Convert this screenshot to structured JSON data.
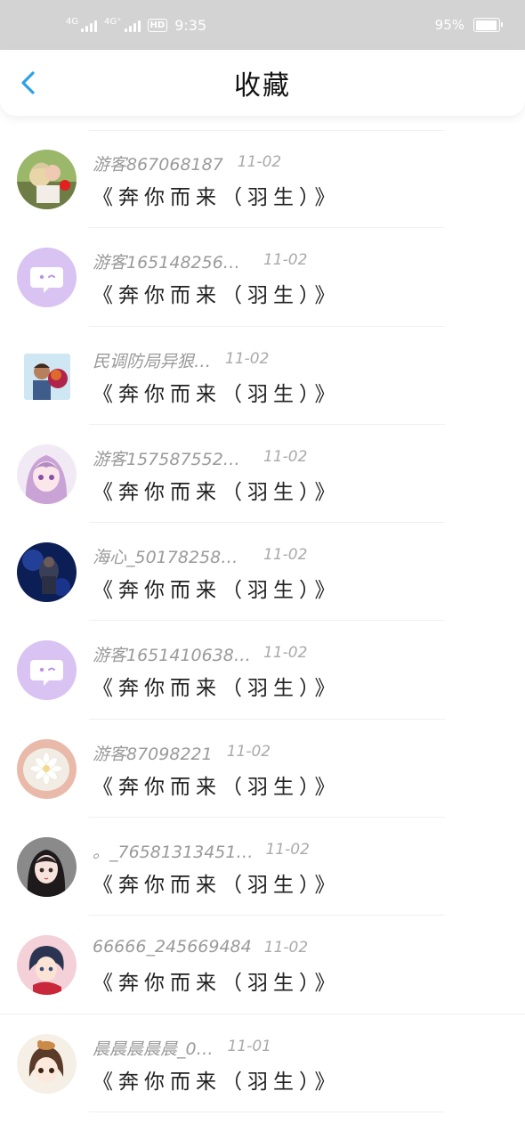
{
  "status_bar": {
    "network1": "4G",
    "network2": "4G⁺",
    "hd": "HD",
    "time": "9:35",
    "battery_text": "95%",
    "battery_level": 0.95
  },
  "header": {
    "title": "收藏",
    "back_icon": "chevron-left-icon",
    "accent_color": "#2e9fe8"
  },
  "favorites": [
    {
      "user": "游客867068187",
      "date": "11-02",
      "title": "《奔你而来（羽生）》",
      "avatar": "photo-couple"
    },
    {
      "user": "游客165148256…",
      "date": "11-02",
      "title": "《奔你而来（羽生）》",
      "avatar": "default-chat"
    },
    {
      "user": "民调防局异狠…",
      "date": "11-02",
      "title": "《奔你而来（羽生）》",
      "avatar": "photo-man"
    },
    {
      "user": "游客157587552…",
      "date": "11-02",
      "title": "《奔你而来（羽生）》",
      "avatar": "anime-girl-purple"
    },
    {
      "user": "海心_50178258…",
      "date": "11-02",
      "title": "《奔你而来（羽生）》",
      "avatar": "photo-night"
    },
    {
      "user": "游客1651410638…",
      "date": "11-02",
      "title": "《奔你而来（羽生）》",
      "avatar": "default-chat"
    },
    {
      "user": "游客87098221",
      "date": "11-02",
      "title": "《奔你而来（羽生）》",
      "avatar": "photo-flower"
    },
    {
      "user": "。_76581313451…",
      "date": "11-02",
      "title": "《奔你而来（羽生）》",
      "avatar": "anime-girl-dark"
    },
    {
      "user": "66666_245669484",
      "date": "11-02",
      "title": "《奔你而来（羽生）》",
      "avatar": "anime-boy"
    },
    {
      "user": "晨晨晨晨晨_0…",
      "date": "11-01",
      "title": "《奔你而来（羽生）》",
      "avatar": "anime-girl-cute"
    }
  ]
}
